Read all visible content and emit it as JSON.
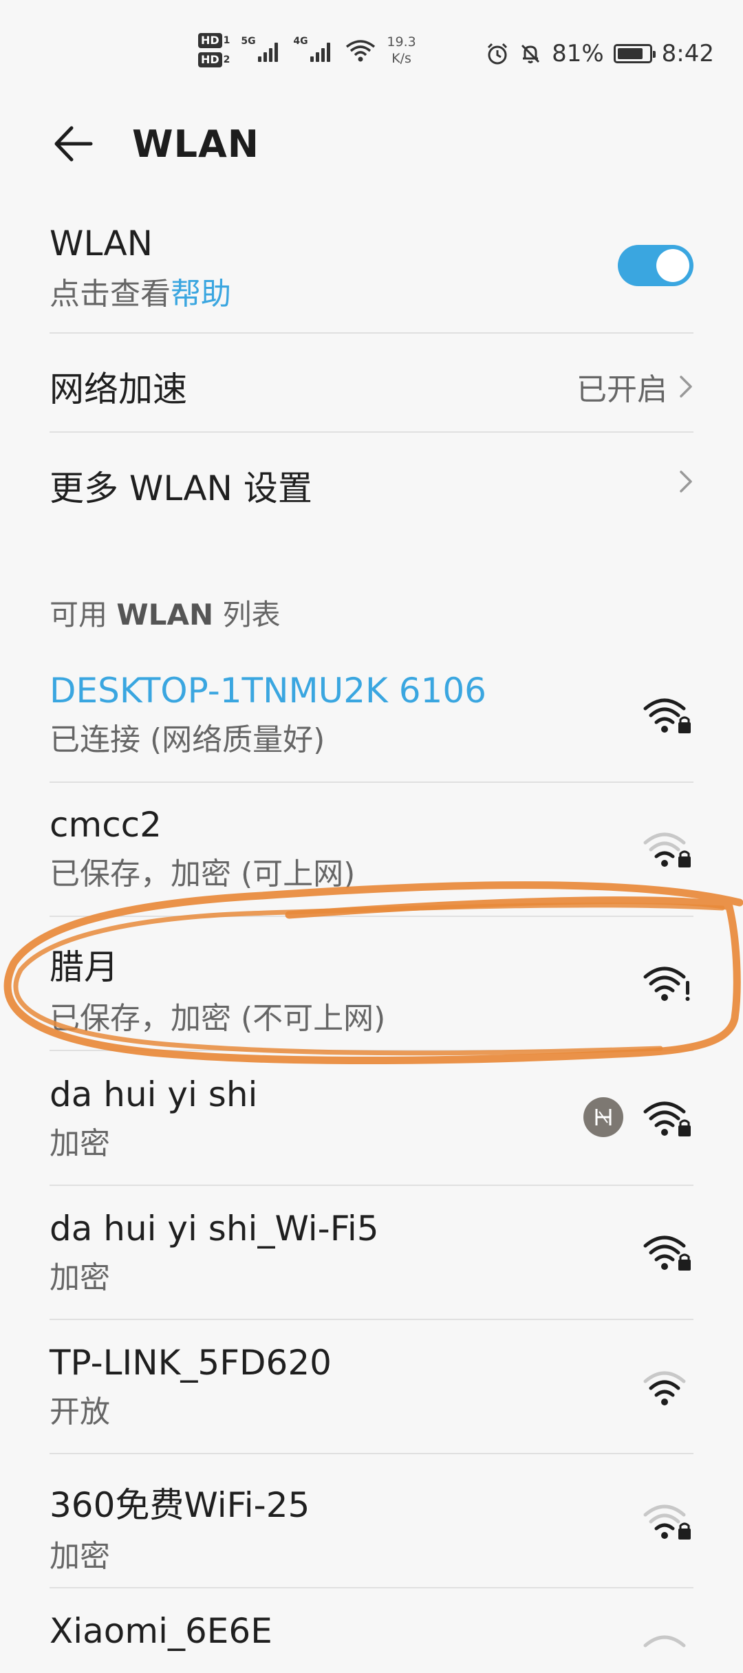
{
  "status_bar": {
    "hd1": "HD",
    "hd1_sub": "1",
    "hd2": "HD",
    "hd2_sub": "2",
    "sim1_tag": "5G",
    "sim2_tag": "4G",
    "speed_value": "19.3",
    "speed_unit": "K/s",
    "battery": "81%",
    "battery_level": 0.81,
    "time": "8:42"
  },
  "header": {
    "title": "WLAN"
  },
  "wlan_toggle": {
    "label": "WLAN",
    "help_prefix": "点击查看",
    "help_link": "帮助",
    "enabled": true
  },
  "network_boost": {
    "label": "网络加速",
    "value": "已开启"
  },
  "more_settings": {
    "label": "更多 WLAN 设置"
  },
  "available_list": {
    "label_prefix": "可用 ",
    "label_bold": "WLAN",
    "label_suffix": " 列表"
  },
  "networks": [
    {
      "name": "DESKTOP-1TNMU2K 6106",
      "status": "已连接 (网络质量好)"
    },
    {
      "name": "cmcc2",
      "status": "已保存，加密 (可上网)"
    },
    {
      "name": "腊月",
      "status": "已保存，加密 (不可上网)"
    },
    {
      "name": "da hui yi shi",
      "status": "加密"
    },
    {
      "name": "da hui yi shi_Wi-Fi5",
      "status": "加密"
    },
    {
      "name": "TP-LINK_5FD620",
      "status": "开放"
    },
    {
      "name": "360免费WiFi-25",
      "status": "加密"
    },
    {
      "name": "Xiaomi_6E6E",
      "status": ""
    }
  ],
  "colors": {
    "accent": "#3aa6e0",
    "marker": "#e8893a",
    "background": "#f7f7f7"
  },
  "icons": {
    "back": "arrow-left-icon",
    "chevron": "chevron-right-icon",
    "wifi": "wifi-lock-icon",
    "wifi_warning": "wifi-warning-icon",
    "wifi_open": "wifi-icon",
    "huawei_share": "hw-share-icon"
  }
}
